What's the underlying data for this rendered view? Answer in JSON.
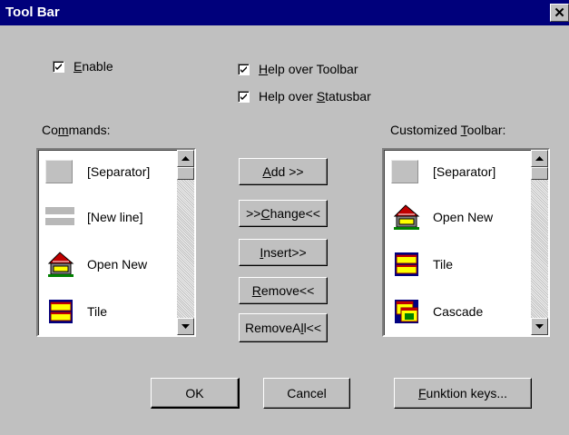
{
  "window": {
    "title": "Tool Bar",
    "close_glyph": "✕"
  },
  "checkboxes": {
    "enable": {
      "label_pre": "",
      "label_acc": "E",
      "label_post": "nable",
      "checked": true
    },
    "help_toolbar": {
      "label_pre": "",
      "label_acc": "H",
      "label_post": "elp over Toolbar",
      "checked": true
    },
    "help_statusbar": {
      "label_pre": "Help over ",
      "label_acc": "S",
      "label_post": "tatusbar",
      "checked": true
    }
  },
  "commands": {
    "label_pre": "Co",
    "label_acc": "m",
    "label_post": "mands:",
    "items": [
      {
        "label": "[Separator]",
        "icon": "separator-icon"
      },
      {
        "label": "[New line]",
        "icon": "newline-icon"
      },
      {
        "label": "Open New",
        "icon": "open-new-icon"
      },
      {
        "label": "Tile",
        "icon": "tile-icon"
      }
    ]
  },
  "customized": {
    "label_pre": "Customized ",
    "label_acc": "T",
    "label_post": "oolbar:",
    "items": [
      {
        "label": "[Separator]",
        "icon": "separator-icon"
      },
      {
        "label": "Open New",
        "icon": "open-new-icon"
      },
      {
        "label": "Tile",
        "icon": "tile-icon"
      },
      {
        "label": "Cascade",
        "icon": "cascade-icon"
      }
    ]
  },
  "actions": {
    "add": {
      "pre": "",
      "acc": "A",
      "post": "dd >>"
    },
    "change": {
      "pre": ">>",
      "acc": "C",
      "post": "hange<<"
    },
    "insert": {
      "pre": "",
      "acc": "I",
      "post": "nsert>>"
    },
    "remove": {
      "pre": "",
      "acc": "R",
      "post": "emove<<"
    },
    "removeall": {
      "pre": "RemoveA",
      "acc": "l",
      "post": "l<<"
    }
  },
  "footer": {
    "ok": "OK",
    "cancel": "Cancel",
    "funktion": {
      "pre": "",
      "acc": "F",
      "post": "unktion keys..."
    }
  }
}
